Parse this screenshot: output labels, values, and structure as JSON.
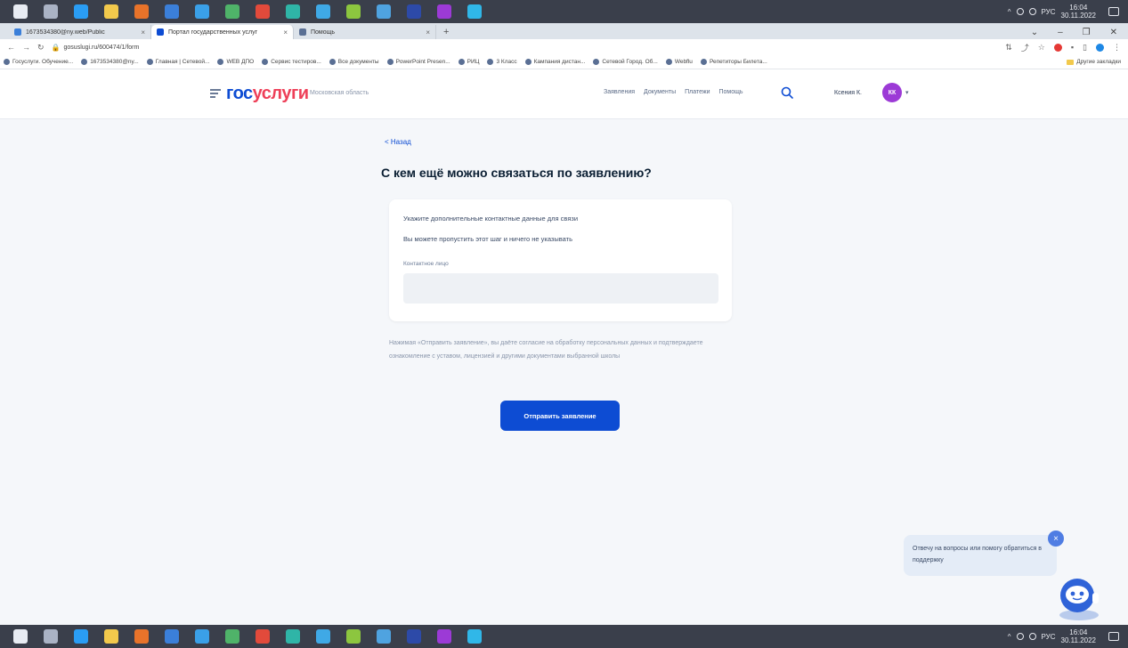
{
  "taskbar": {
    "icons": [
      {
        "name": "windows-start-icon",
        "color": "#e8ecf3"
      },
      {
        "name": "search-icon",
        "color": "#aab3c5"
      },
      {
        "name": "chrome-icon",
        "color": "#2a9df4"
      },
      {
        "name": "explorer-icon",
        "color": "#f2c94c"
      },
      {
        "name": "app-icon-orange",
        "color": "#e8732a"
      },
      {
        "name": "app-icon-blue",
        "color": "#3b7fd9"
      },
      {
        "name": "edge-icon",
        "color": "#3aa0e8"
      },
      {
        "name": "app-icon-green",
        "color": "#4fb369"
      },
      {
        "name": "app-icon-red",
        "color": "#e24a3b"
      },
      {
        "name": "app-icon-teal",
        "color": "#2fb5a7"
      },
      {
        "name": "telegram-icon",
        "color": "#3fa9e6"
      },
      {
        "name": "app-icon-lime",
        "color": "#8cc63f"
      },
      {
        "name": "app-icon-sky",
        "color": "#4fa3e0"
      },
      {
        "name": "app-icon-navy",
        "color": "#2d4aa8"
      },
      {
        "name": "app-icon-purple",
        "color": "#9c3ad6"
      },
      {
        "name": "app-icon-cyan",
        "color": "#30b7e8"
      }
    ],
    "tray_lang": "РУС",
    "clock_time": "16:04",
    "clock_date": "30.11.2022"
  },
  "browser": {
    "tabs": [
      {
        "label": "1673534380@ny.web/Public",
        "active": false,
        "fav_color": "#3b7fd9"
      },
      {
        "label": "Портал государственных услуг",
        "active": true,
        "fav_color": "#0d4cd3"
      },
      {
        "label": "Помощь",
        "active": false,
        "fav_color": "#5a6f94"
      }
    ],
    "new_tab": "+",
    "url": "gosuslugi.ru/600474/1/form",
    "bookmarks": [
      "Госуслуги. Обучение...",
      "1673534380@ny...",
      "Главная | Сетевой...",
      "WEB ДПО",
      "Сервис тестиров...",
      "Все документы",
      "PowerPoint Presen...",
      "РИЦ",
      "3 Класс",
      "Кампания дистан...",
      "Сетевой Город. Об...",
      "Webflu",
      "Репетиторы Билета..."
    ],
    "bookmarks_other": "Другие закладки"
  },
  "site": {
    "logo_part1": "гос",
    "logo_part2": "услуги",
    "region": "Московская область",
    "nav": [
      "Заявления",
      "Документы",
      "Платежи",
      "Помощь"
    ],
    "user_name": "Ксения К.",
    "avatar_initials": "КК",
    "accent": "#0d4cd3",
    "logo_red": "#ee3f58"
  },
  "form": {
    "back": "< Назад",
    "title": "С кем ещё можно связаться по заявлению?",
    "line1": "Укажите дополнительные контактные данные для связи",
    "line2": "Вы можете пропустить этот шаг и ничего не указывать",
    "field_label": "Контактное лицо",
    "field_value": "",
    "field_placeholder": "",
    "consent": "Нажимая «Отправить заявление», вы даёте согласие на обработку персональных данных и подтверждаете ознакомление с уставом, лицензией и другими документами выбранной школы",
    "submit": "Отправить заявление"
  },
  "chat": {
    "text": "Отвечу на вопросы или помогу обратиться в поддержку",
    "close": "×"
  }
}
